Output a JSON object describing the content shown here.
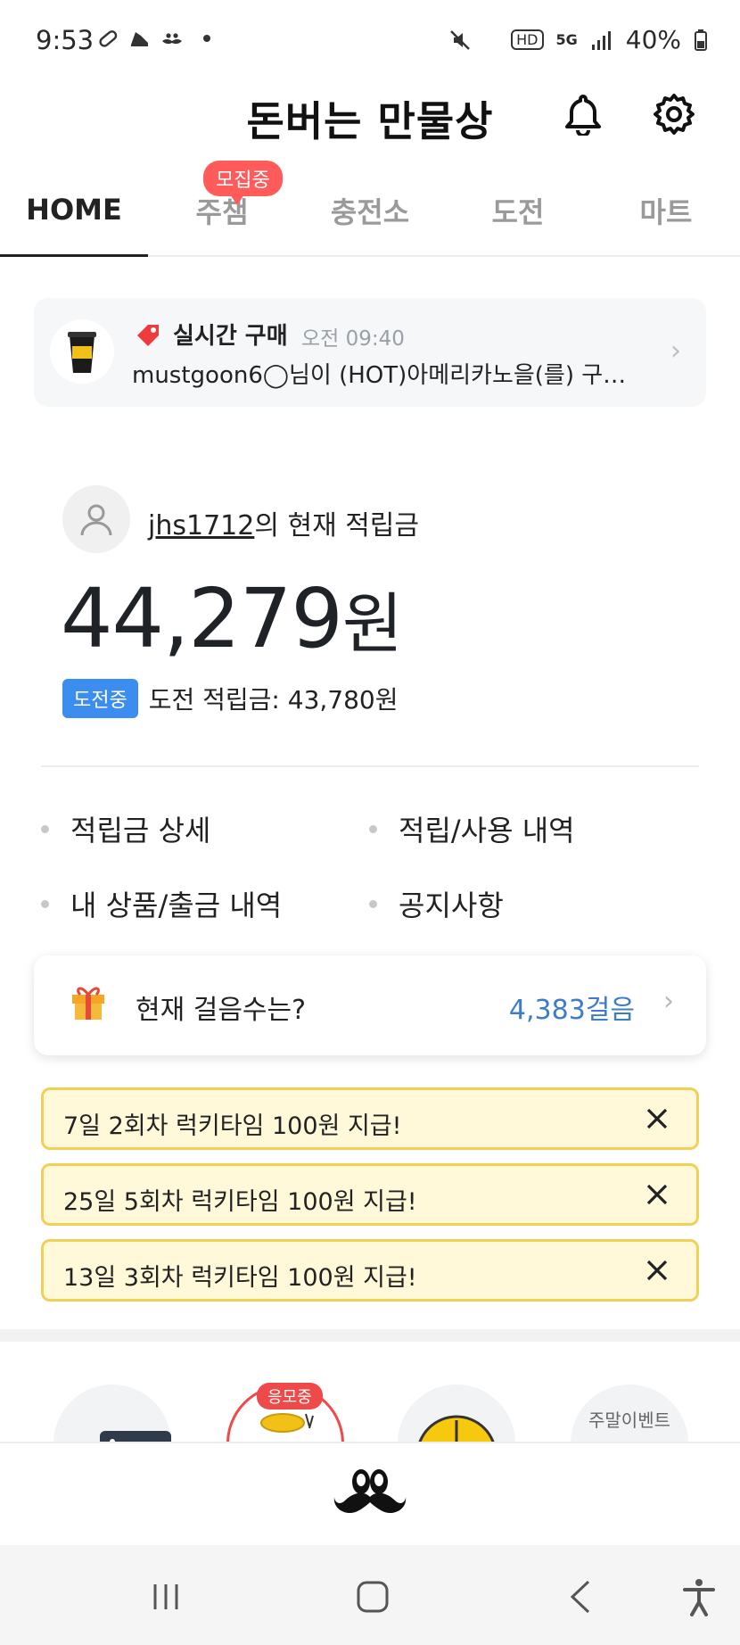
{
  "status_bar": {
    "time": "9:53",
    "network": "5G",
    "battery": "40%"
  },
  "header": {
    "title": "돈버는 만물상"
  },
  "tabs": [
    {
      "label": "HOME",
      "active": true
    },
    {
      "label": "주챔",
      "badge": "모집중"
    },
    {
      "label": "충전소"
    },
    {
      "label": "도전"
    },
    {
      "label": "마트"
    }
  ],
  "live_purchase": {
    "label": "실시간 구매",
    "time": "오전 09:40",
    "message": "mustgoon6◯님이 (HOT)아메리카노을(를) 구…"
  },
  "user": {
    "username": "jhs1712",
    "suffix": "의 현재 적립금",
    "balance_number": "44,279",
    "balance_unit": "원",
    "challenge_badge": "도전중",
    "challenge_text": "도전 적립금: 43,780원"
  },
  "menu": {
    "item1": "적립금 상세",
    "item2": "적립/사용 내역",
    "item3": "내 상품/출금 내역",
    "item4": "공지사항"
  },
  "steps": {
    "label": "현재 걸음수는?",
    "value": "4,383걸음"
  },
  "notices": [
    "7일 2회차 럭키타임 100원 지급!",
    "25일 5회차 럭키타임 100원 지급!",
    "13일 3회차 럭키타임 100원 지급!"
  ],
  "promos": {
    "badge": "응모중",
    "event_label": "주말이벤트"
  },
  "colors": {
    "accent_blue": "#3c8df0",
    "badge_red": "#ff5b5b",
    "notice_bg": "#fff8d9",
    "notice_border": "#f2cf55"
  }
}
